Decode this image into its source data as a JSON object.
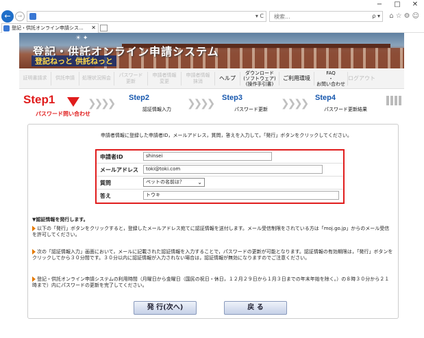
{
  "browser": {
    "window_controls": [
      "−",
      "□",
      "✕"
    ],
    "back_glyph": "←",
    "forward_glyph": "→",
    "address_controls": "▾ C",
    "search_placeholder": "検索...",
    "search_glyph": "ρ ▾",
    "toolbar_icons": "⌂☆⚙☺",
    "tab_title": "登記・供託オンライン申請シス...",
    "tab_close": "✕"
  },
  "banner": {
    "title": "登記・供託オンライン申請システム",
    "subtitle": "登記ねっと 供託ねっと",
    "ornament": "☀ ✦"
  },
  "menu": {
    "items": [
      {
        "label": "証明書請求"
      },
      {
        "label": "供託申請"
      },
      {
        "label": "処理状況照会"
      },
      {
        "label": "パスワード\n更新"
      },
      {
        "label": "申請者情報\n変更"
      },
      {
        "label": "申請者情報\n抹消"
      },
      {
        "label": "ヘルプ"
      },
      {
        "label": "ダウンロード\n(ソフトウェア)\n(操作手引書)"
      },
      {
        "label": "ご利用環境"
      },
      {
        "label": "FAQ\n・\nお問い合わせ"
      },
      {
        "label": "ログアウト"
      }
    ]
  },
  "steps": {
    "step1": {
      "label": "Step1",
      "sub": "パスワード問い合わせ"
    },
    "step2": {
      "label": "Step2",
      "sub": "認証情報入力"
    },
    "step3": {
      "label": "Step3",
      "sub": "パスワード更新"
    },
    "step4": {
      "label": "Step4",
      "sub": "パスワード更新結果"
    },
    "chevron": "❯❯❯❯"
  },
  "form": {
    "intro": "申請者情報に登録した申請者ID，メールアドレス，質問，答えを入力して，「発行」ボタンをクリックしてください。",
    "applicant_id": {
      "label": "申請者ID",
      "value": "shinsei"
    },
    "email": {
      "label": "メールアドレス",
      "value": "toki@toki.com"
    },
    "question": {
      "label": "質問",
      "value": "ペットの名前は？"
    },
    "answer": {
      "label": "答え",
      "value": "トウキ"
    }
  },
  "notice": {
    "heading": "▼認証情報を発行します。",
    "items": [
      "以下の「発行」ボタンをクリックすると，登録したメールアドレス宛てに認証情報を送付します。メール受信制限をされている方は「moj.go.jp」からのメール受信を許可してください。",
      "次の「認証情報入力」画面において，メールに記載された認証情報を入力することで，パスワードの更新が可能となります。認証情報の有効期限は，「発行」ボタンをクリックしてから３０分間です。３０分以内に認証情報が入力されない場合は，認証情報が無効になりますのでご注意ください。",
      "登記・供託オンライン申請システムの利用時間（月曜日から金曜日（国民の祝日・休日，１２月２９日から１月３日までの年末年始を除く。）の８時３０分から２１時まで）内にパスワードの更新を完了してください。"
    ]
  },
  "buttons": {
    "issue": "発 行(次へ)",
    "back": "戻 る"
  },
  "colors": {
    "step_active": "#e01c1c",
    "step_inactive": "#1556ad",
    "form_border": "#e01c1c",
    "notice_bullet": "#e57a00"
  }
}
